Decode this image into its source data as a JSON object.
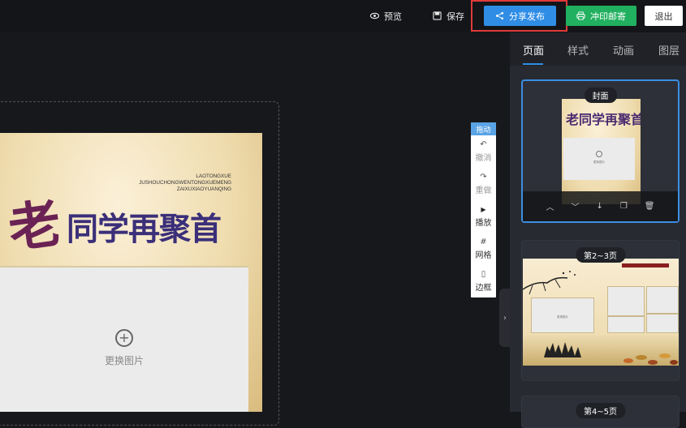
{
  "topbar": {
    "preview_label": "预览",
    "save_label": "保存",
    "share_label": "分享发布",
    "print_label": "冲印邮寄",
    "exit_label": "退出"
  },
  "canvas": {
    "title_first_char": "老",
    "title_rest": "同学再聚首",
    "pinyin_lines": [
      "LAOTONGXUE",
      "JUSHOUCHONGWENTONGXUEMENG",
      "ZAIXUXIAOYUANQING"
    ],
    "replace_photo_label": "更换图片"
  },
  "tools": {
    "drag_label": "拖动",
    "items": [
      {
        "icon": "undo-icon",
        "glyph": "↶",
        "label": "撤消"
      },
      {
        "icon": "redo-icon",
        "glyph": "↷",
        "label": "重做"
      },
      {
        "icon": "play-icon",
        "glyph": "▶",
        "label": "播放"
      },
      {
        "icon": "grid-icon",
        "glyph": "#",
        "label": "网格"
      },
      {
        "icon": "border-icon",
        "glyph": "▯",
        "label": "边框"
      }
    ]
  },
  "panel": {
    "tabs": [
      "页面",
      "样式",
      "动画",
      "图层"
    ],
    "active_tab": "页面",
    "cards": [
      {
        "label": "封面",
        "mini_title": "老同学再聚首",
        "photo_text": "更换图片"
      },
      {
        "label": "第2~3页",
        "photo_text": "更换图片"
      },
      {
        "label": "第4~5页"
      }
    ],
    "card_actions": [
      "move-up-icon",
      "move-down-icon",
      "insert-below-icon",
      "copy-icon",
      "delete-icon"
    ]
  },
  "colors": {
    "accent_blue": "#2f8de6",
    "print_green": "#21b05f",
    "highlight_red": "#e03a3a",
    "background": "#17181c",
    "panel": "#272a31"
  }
}
